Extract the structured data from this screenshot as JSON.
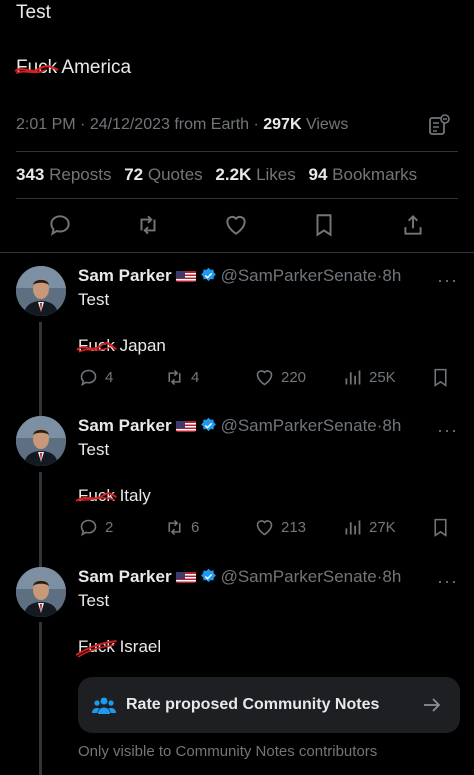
{
  "main_tweet": {
    "line1": "Test",
    "line2_struck": "Fuck",
    "line2_rest": " America",
    "time": "2:01 PM",
    "date": "24/12/2023",
    "source": "from Earth",
    "views_count": "297K",
    "views_label": "Views",
    "reposts_count": "343",
    "reposts_label": "Reposts",
    "quotes_count": "72",
    "quotes_label": "Quotes",
    "likes_count": "2.2K",
    "likes_label": "Likes",
    "bookmarks_count": "94",
    "bookmarks_label": "Bookmarks"
  },
  "replies": [
    {
      "name": "Sam Parker",
      "handle": "@SamParkerSenate",
      "time": "8h",
      "line1": "Test",
      "struck": "Fuck",
      "rest": " Japan",
      "replies": "4",
      "reposts": "4",
      "likes": "220",
      "views": "25K"
    },
    {
      "name": "Sam Parker",
      "handle": "@SamParkerSenate",
      "time": "8h",
      "line1": "Test",
      "struck": "Fuck",
      "rest": " Italy",
      "replies": "2",
      "reposts": "6",
      "likes": "213",
      "views": "27K"
    },
    {
      "name": "Sam Parker",
      "handle": "@SamParkerSenate",
      "time": "8h",
      "line1": "Test",
      "struck": "Fuck",
      "rest": " Israel"
    }
  ],
  "community_notes": {
    "button_label": "Rate proposed Community Notes",
    "subtext": "Only visible to Community Notes contributors"
  },
  "colors": {
    "background": "#000000",
    "text": "#e7e9ea",
    "muted": "#71767b",
    "divider": "#2f3336",
    "verified": "#1d9bf0",
    "strike": "#d21f1f"
  },
  "icons": [
    "reply-icon",
    "repost-icon",
    "like-icon",
    "bookmark-icon",
    "share-icon",
    "views-icon",
    "verified-badge-icon",
    "us-flag-icon",
    "more-icon",
    "people-icon",
    "arrow-right-icon",
    "analytics-icon"
  ]
}
